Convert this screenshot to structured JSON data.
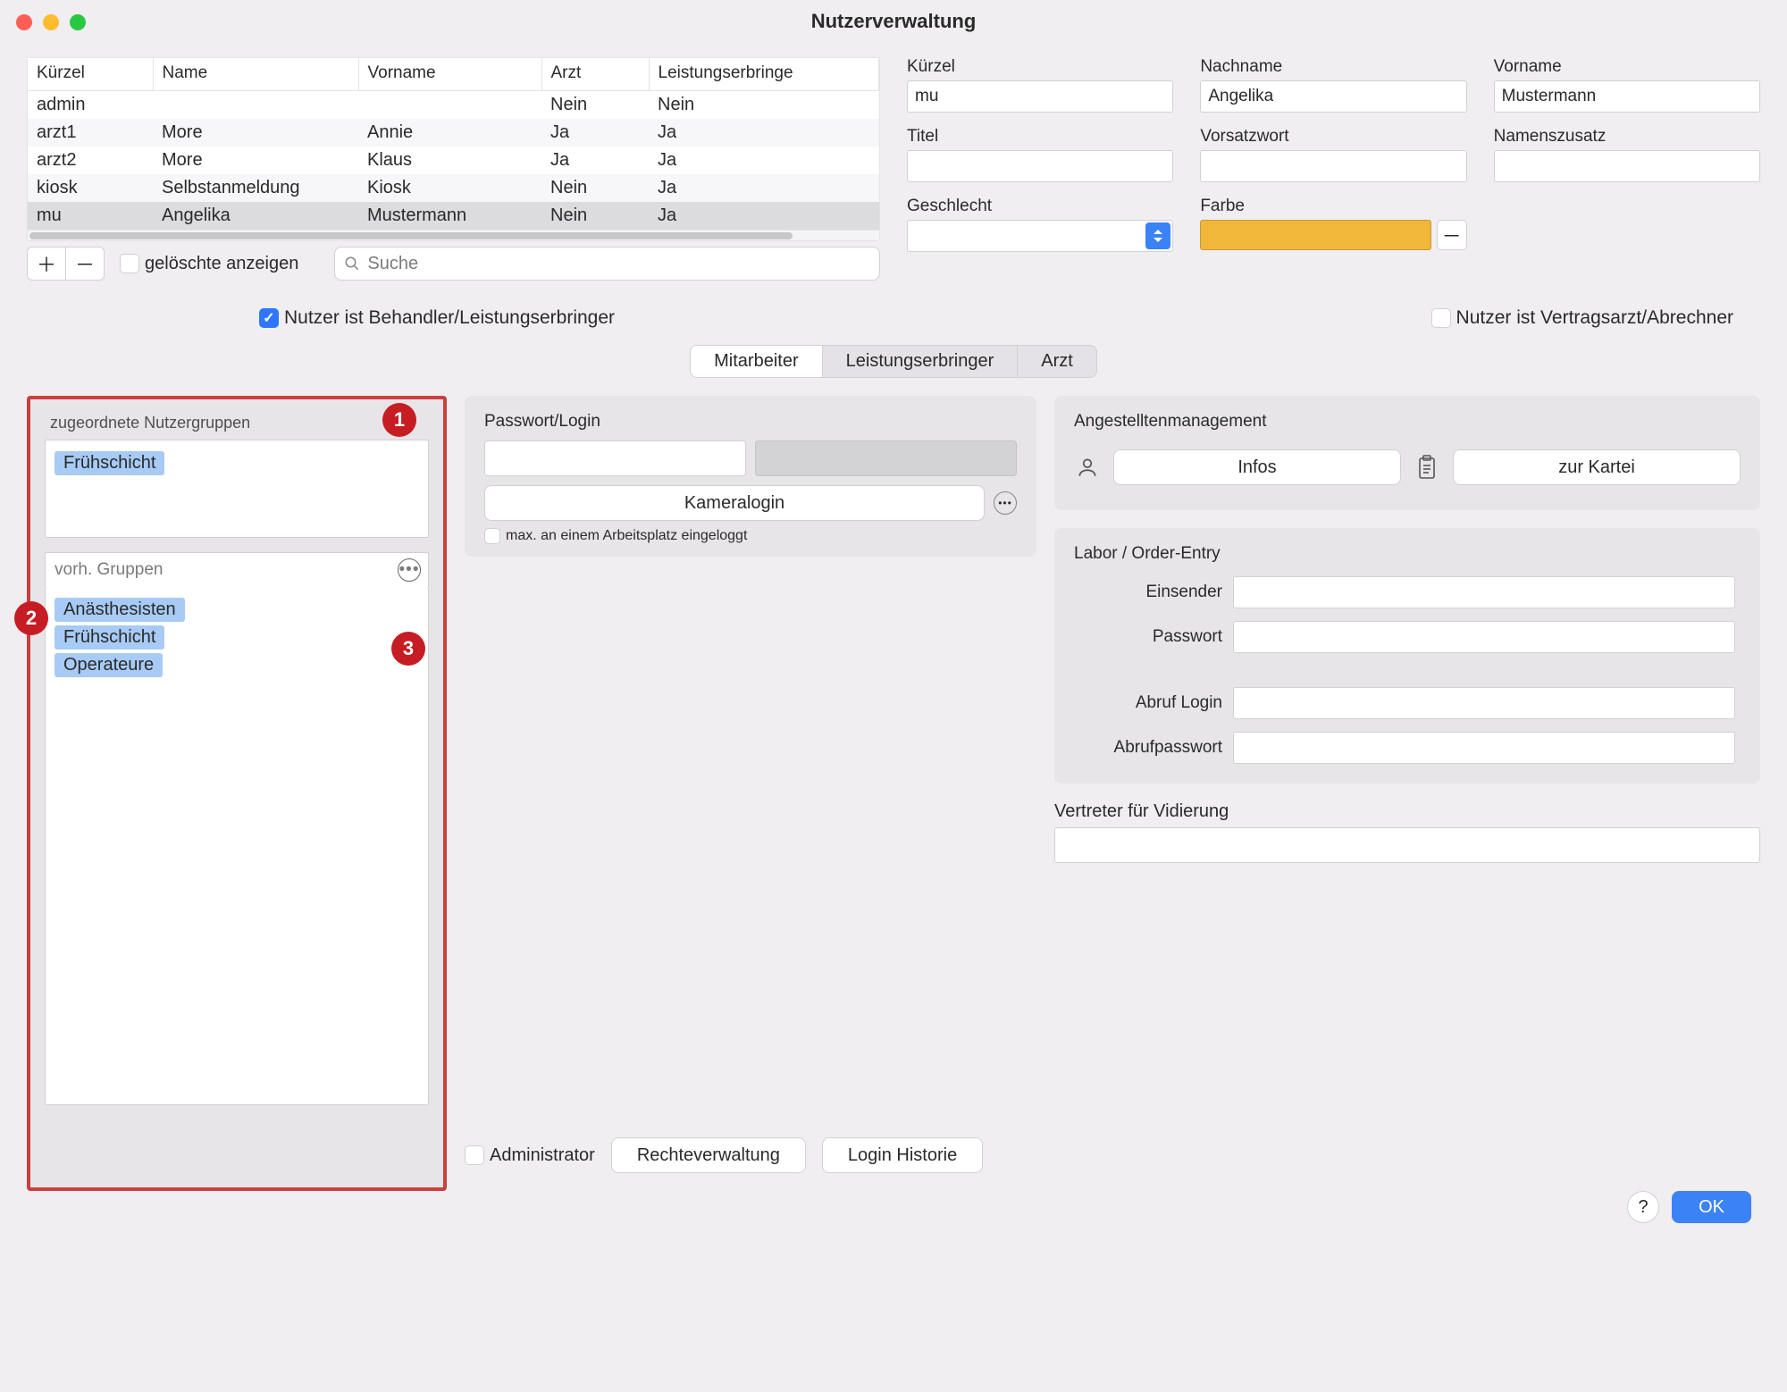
{
  "window": {
    "title": "Nutzerverwaltung"
  },
  "table": {
    "headers": {
      "kuerzel": "Kürzel",
      "name": "Name",
      "vorname": "Vorname",
      "arzt": "Arzt",
      "leistung": "Leistungserbringe"
    },
    "rows": [
      {
        "kuerzel": "admin",
        "name": "",
        "vorname": "",
        "arzt": "Nein",
        "leistung": "Nein"
      },
      {
        "kuerzel": "arzt1",
        "name": "More",
        "vorname": "Annie",
        "arzt": "Ja",
        "leistung": "Ja"
      },
      {
        "kuerzel": "arzt2",
        "name": "More",
        "vorname": "Klaus",
        "arzt": "Ja",
        "leistung": "Ja"
      },
      {
        "kuerzel": "kiosk",
        "name": "Selbstanmeldung",
        "vorname": "Kiosk",
        "arzt": "Nein",
        "leistung": "Ja"
      },
      {
        "kuerzel": "mu",
        "name": "Angelika",
        "vorname": "Mustermann",
        "arzt": "Nein",
        "leistung": "Ja"
      }
    ],
    "footer": {
      "add": "＋",
      "remove": "－",
      "deleted_label": "gelöschte anzeigen",
      "search_placeholder": "Suche"
    }
  },
  "form": {
    "kuerzel_label": "Kürzel",
    "kuerzel_value": "mu",
    "nachname_label": "Nachname",
    "nachname_value": "Angelika",
    "vorname_label": "Vorname",
    "vorname_value": "Mustermann",
    "titel_label": "Titel",
    "titel_value": "",
    "vorsatzwort_label": "Vorsatzwort",
    "vorsatzwort_value": "",
    "namenszusatz_label": "Namenszusatz",
    "namenszusatz_value": "",
    "geschlecht_label": "Geschlecht",
    "geschlecht_value": "",
    "farbe_label": "Farbe",
    "farbe_value": "#f1b73b"
  },
  "roles": {
    "behandler": "Nutzer ist Behandler/Leistungserbringer",
    "vertragsarzt": "Nutzer ist Vertragsarzt/Abrechner"
  },
  "tabs": {
    "mitarbeiter": "Mitarbeiter",
    "leistung": "Leistungserbringer",
    "arzt": "Arzt"
  },
  "groups": {
    "assigned_label": "zugeordnete Nutzergruppen",
    "assigned": [
      "Frühschicht"
    ],
    "available_label": "vorh. Gruppen",
    "available": [
      "Anästhesisten",
      "Frühschicht",
      "Operateure"
    ]
  },
  "badges": {
    "one": "1",
    "two": "2",
    "three": "3"
  },
  "password_panel": {
    "title": "Passwort/Login",
    "camera_login": "Kameralogin",
    "max_one": "max. an einem Arbeitsplatz eingeloggt"
  },
  "mgmt_panel": {
    "title": "Angestelltenmanagement",
    "infos": "Infos",
    "zur_kartei": "zur Kartei"
  },
  "labor_panel": {
    "title": "Labor / Order-Entry",
    "einsender": "Einsender",
    "passwort": "Passwort",
    "abruf_login": "Abruf Login",
    "abruf_passwort": "Abrufpasswort"
  },
  "vertreter": {
    "label": "Vertreter für Vidierung"
  },
  "admin_bar": {
    "administrator": "Administrator",
    "rechte": "Rechteverwaltung",
    "login_hist": "Login Historie"
  },
  "footer": {
    "help": "?",
    "ok": "OK"
  }
}
